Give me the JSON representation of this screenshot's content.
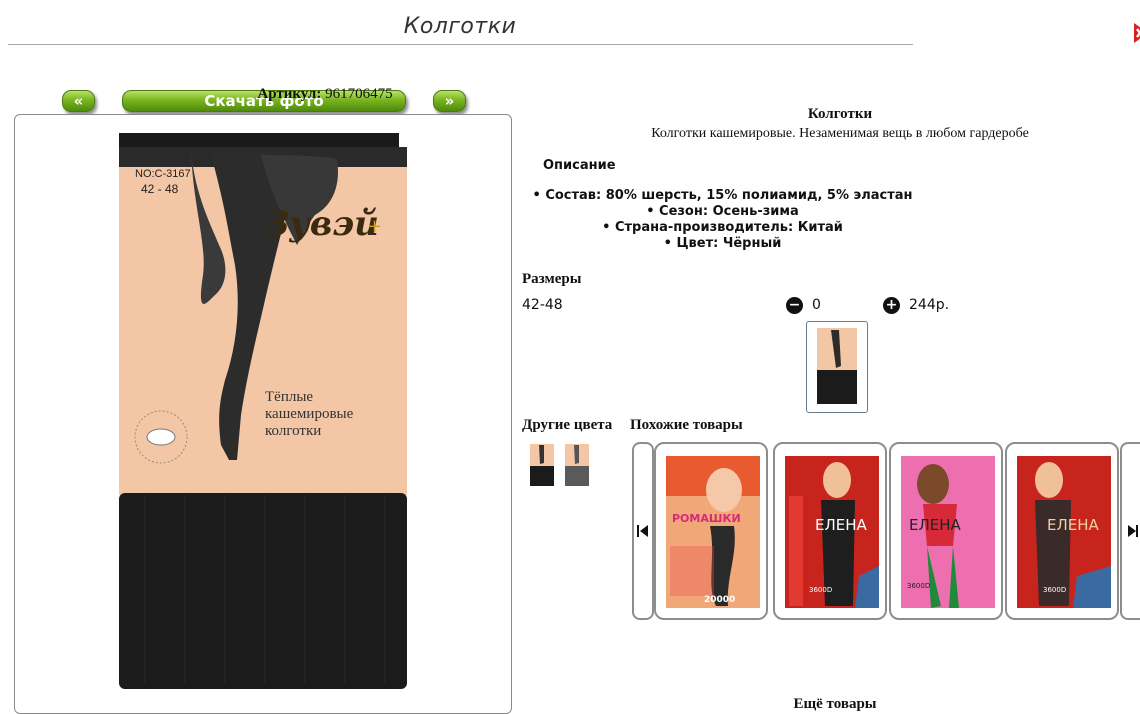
{
  "page": {
    "title": "Колготки"
  },
  "gallery": {
    "prev_label": "«",
    "download_label": "Скачать фото",
    "next_label": "»"
  },
  "photo": {
    "code": "NO:C-3167",
    "size_range": "42 - 48",
    "brand": "Зувэй",
    "brand_mark": "+",
    "caption_line1": "Тёплые",
    "caption_line2": "кашемировые",
    "caption_line3": "колготки"
  },
  "product": {
    "article_label": "Артикул:",
    "article_value": "961706475",
    "name": "Колготки",
    "description": "Колготки кашемировые. Незаменимая вещь в любом гардеробе"
  },
  "description": {
    "heading": "Описание",
    "items": [
      "• Состав: 80% шерсть, 15% полиамид, 5% эластан",
      "• Сезон: Осень-зима",
      "• Страна-производитель: Китай",
      "• Цвет: Чёрный"
    ]
  },
  "sizes": {
    "heading": "Размеры",
    "rows": [
      {
        "size": "42-48",
        "minus": "−",
        "quantity": "0",
        "plus": "+",
        "price": "244р."
      }
    ]
  },
  "other_colors": {
    "heading": "Другие цвета"
  },
  "similar": {
    "heading": "Похожие товары",
    "items": [
      {
        "brand": "РОМАШКИ",
        "note": "20000"
      },
      {
        "brand": "ЕЛЕНА",
        "note": "3600D"
      },
      {
        "brand": "ЕЛЕНА",
        "note": "3600D"
      },
      {
        "brand": "ЕЛЕНА",
        "note": "3600D"
      }
    ]
  },
  "more": {
    "heading": "Ещё товары"
  },
  "colors": {
    "accent_green": "#7ab51f",
    "close_red": "#d81e1e"
  }
}
